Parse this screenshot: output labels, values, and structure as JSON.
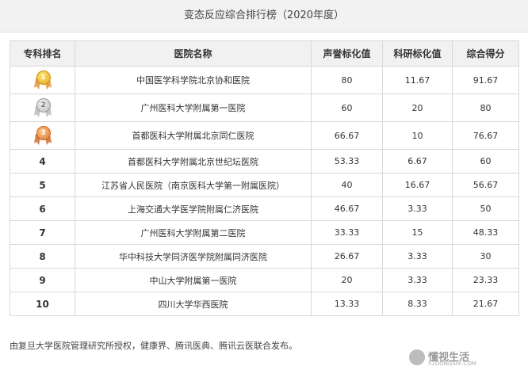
{
  "title": "变态反应综合排行榜（2020年度）",
  "table": {
    "headers": [
      "专科排名",
      "医院名称",
      "声誉标化值",
      "科研标化值",
      "综合得分"
    ],
    "rows": [
      {
        "rank": "1",
        "hospital": "中国医学科学院北京协和医院",
        "reputation": "80",
        "research": "11.67",
        "score": "91.67"
      },
      {
        "rank": "2",
        "hospital": "广州医科大学附属第一医院",
        "reputation": "60",
        "research": "20",
        "score": "80"
      },
      {
        "rank": "3",
        "hospital": "首都医科大学附属北京同仁医院",
        "reputation": "66.67",
        "research": "10",
        "score": "76.67"
      },
      {
        "rank": "4",
        "hospital": "首都医科大学附属北京世纪坛医院",
        "reputation": "53.33",
        "research": "6.67",
        "score": "60"
      },
      {
        "rank": "5",
        "hospital": "江苏省人民医院（南京医科大学第一附属医院）",
        "reputation": "40",
        "research": "16.67",
        "score": "56.67"
      },
      {
        "rank": "6",
        "hospital": "上海交通大学医学院附属仁济医院",
        "reputation": "46.67",
        "research": "3.33",
        "score": "50"
      },
      {
        "rank": "7",
        "hospital": "广州医科大学附属第二医院",
        "reputation": "33.33",
        "research": "15",
        "score": "48.33"
      },
      {
        "rank": "8",
        "hospital": "华中科技大学同济医学院附属同济医院",
        "reputation": "26.67",
        "research": "3.33",
        "score": "30"
      },
      {
        "rank": "9",
        "hospital": "中山大学附属第一医院",
        "reputation": "20",
        "research": "3.33",
        "score": "23.33"
      },
      {
        "rank": "10",
        "hospital": "四川大学华西医院",
        "reputation": "13.33",
        "research": "8.33",
        "score": "21.67"
      }
    ]
  },
  "medal_icons": [
    "gold-medal-icon",
    "silver-medal-icon",
    "bronze-medal-icon"
  ],
  "colors": {
    "gold": "#e6a917",
    "silver": "#b9b9b9",
    "bronze": "#e07a30",
    "header_bg": "#f1f1f1"
  },
  "footer": "由复旦大学医院管理研究所授权，健康界、腾讯医典、腾讯云医联合发布。",
  "watermark": {
    "name": "懂视生活",
    "url": "51DONGSHI.COM"
  }
}
